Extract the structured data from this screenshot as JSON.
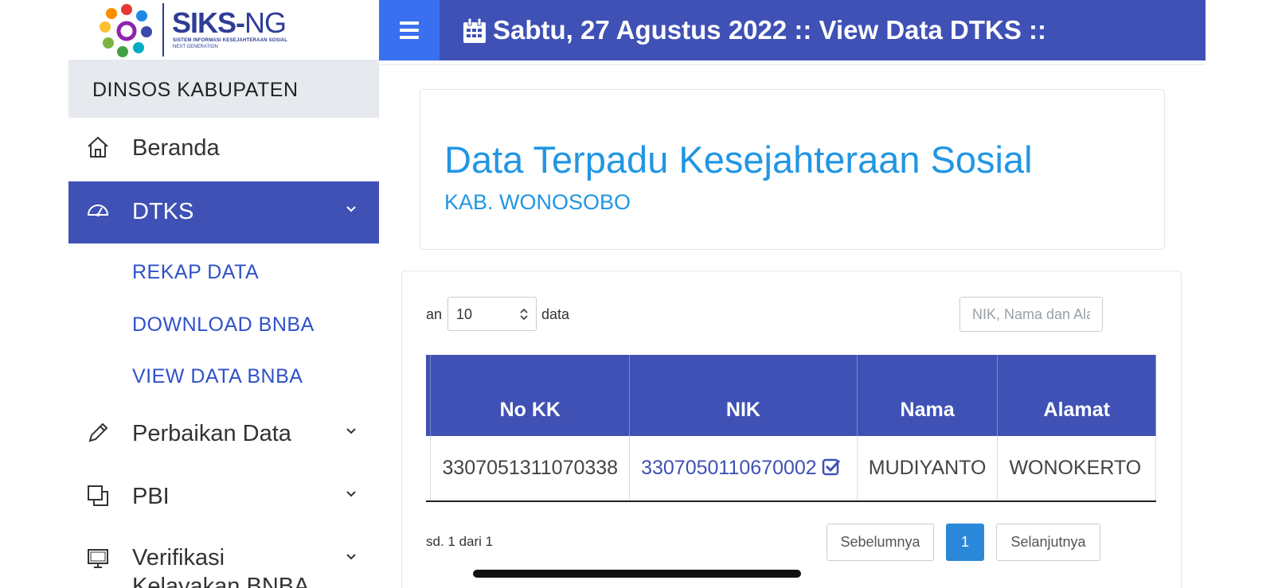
{
  "logo": {
    "title_bold": "SIKS-",
    "title_light": "NG",
    "subtitle": "SISTEM INFORMASI KESEJAHTERAAN SOSIAL",
    "tagline": "NEXT GENERATION"
  },
  "sidebar": {
    "org": "DINSOS KABUPATEN",
    "items": [
      {
        "label": "Beranda",
        "icon": "home-icon"
      },
      {
        "label": "DTKS",
        "icon": "dashboard-gauge-icon",
        "active": true
      },
      {
        "label": "Perbaikan Data",
        "icon": "pencil-icon"
      },
      {
        "label": "PBI",
        "icon": "clone-icon"
      },
      {
        "label": "Verifikasi Kelayakan BNBA",
        "icon": "monitor-icon"
      }
    ],
    "sub_items": [
      "REKAP DATA",
      "DOWNLOAD BNBA",
      "VIEW DATA BNBA"
    ]
  },
  "header": {
    "title": "Sabtu, 27 Agustus 2022 :: View Data DTKS ::"
  },
  "banner": {
    "heading": "Data Terpadu Kesejahteraan Sosial",
    "subheading": "KAB. WONOSOBO"
  },
  "table_controls": {
    "show_prefix": "an",
    "page_size": "10",
    "show_suffix": "data",
    "search_placeholder": "NIK, Nama dan Alamat"
  },
  "table": {
    "headers": [
      "No KK",
      "NIK",
      "Nama",
      "Alamat"
    ],
    "rows": [
      {
        "no_kk": "3307051311070338",
        "nik": "3307050110670002",
        "nama": "MUDIYANTO",
        "alamat": "WONOKERTO"
      }
    ]
  },
  "pagination": {
    "info": "sd. 1 dari 1",
    "prev": "Sebelumnya",
    "current": "1",
    "next": "Selanjutnya"
  },
  "colors": {
    "primary": "#3f51b5",
    "accent": "#2196e3",
    "hamburger": "#3a6ff0"
  }
}
